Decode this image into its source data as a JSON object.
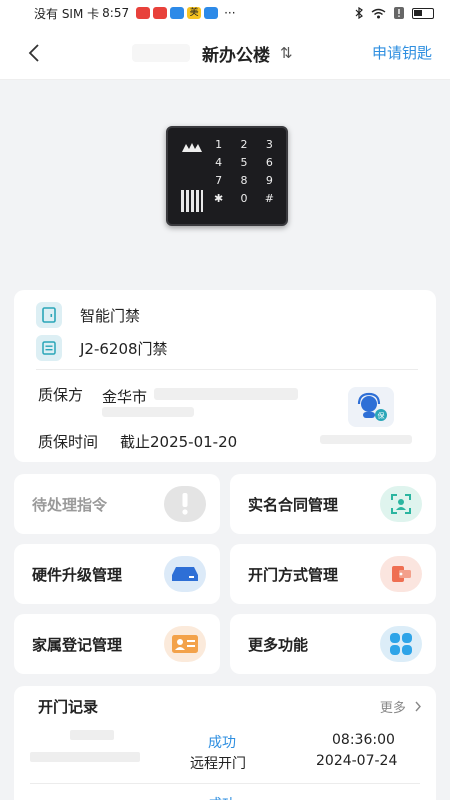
{
  "status_bar": {
    "carrier": "没有 SIM 卡",
    "time": "8:57",
    "more": "···",
    "app_icons": [
      {
        "name": "red-app-icon",
        "color": "#e8413b"
      },
      {
        "name": "red-app-icon",
        "color": "#e8413b"
      },
      {
        "name": "blue-app-icon",
        "color": "#2d8ae8"
      },
      {
        "name": "meituan-icon",
        "color": "#f6c321",
        "text": "美"
      },
      {
        "name": "blue-app-icon",
        "color": "#2d8ae8"
      }
    ]
  },
  "nav": {
    "title": "新办公楼",
    "swap_symbol": "⇅",
    "apply_key_label": "申请钥匙"
  },
  "device": {
    "keys": [
      "1",
      "2",
      "3",
      "4",
      "5",
      "6",
      "7",
      "8",
      "9",
      "✱",
      "0",
      "#"
    ]
  },
  "info": {
    "type_label": "智能门禁",
    "door_label": "J2-6208门禁",
    "warranty_provider_label": "质保方",
    "warranty_provider_value": "金华市",
    "warranty_time_label": "质保时间",
    "warranty_time_value": "截止2025-01-20"
  },
  "tiles": [
    {
      "label": "待处理指令",
      "icon": "alert-icon",
      "muted": true,
      "bg": "#e4e4e4"
    },
    {
      "label": "实名合同管理",
      "icon": "face-id-icon",
      "muted": false,
      "bg": "#dff4ee"
    },
    {
      "label": "硬件升级管理",
      "icon": "hardware-icon",
      "muted": false,
      "bg": "#dceaf8"
    },
    {
      "label": "开门方式管理",
      "icon": "card-door-icon",
      "muted": false,
      "bg": "#fbe5df"
    },
    {
      "label": "家属登记管理",
      "icon": "id-card-icon",
      "muted": false,
      "bg": "#fbeadb"
    },
    {
      "label": "更多功能",
      "icon": "grid-icon",
      "muted": false,
      "bg": "#dcedf8"
    }
  ],
  "records": {
    "title": "开门记录",
    "more_label": "更多",
    "rows": [
      {
        "status": "成功",
        "method": "远程开门",
        "time": "08:36:00",
        "date": "2024-07-24"
      },
      {
        "status": "成功"
      }
    ]
  },
  "colors": {
    "accent": "#2f8fe0",
    "background": "#f2f3f5"
  }
}
